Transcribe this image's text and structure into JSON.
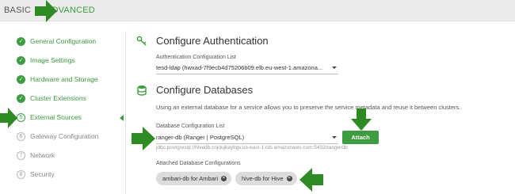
{
  "header": {
    "basic_tab": "BASIC",
    "advanced_tab": "ADVANCED"
  },
  "nav": {
    "items": [
      {
        "number": "",
        "label": "General Configuration",
        "state": "done"
      },
      {
        "number": "",
        "label": "Image Settings",
        "state": "done"
      },
      {
        "number": "",
        "label": "Hardware and Storage",
        "state": "done"
      },
      {
        "number": "",
        "label": "Cluster Extensions",
        "state": "done"
      },
      {
        "number": "5",
        "label": "External Sources",
        "state": "current"
      },
      {
        "number": "6",
        "label": "Gateway Configuration",
        "state": "pending"
      },
      {
        "number": "7",
        "label": "Network",
        "state": "pending"
      },
      {
        "number": "8",
        "label": "Security",
        "state": "pending"
      }
    ]
  },
  "auth": {
    "title": "Configure Authentication",
    "list_label": "Authentication Configuration List",
    "selected": "tesd-ldap (hwxad-7f9ecb4d75206b09.elb.eu-west-1.amazona..."
  },
  "databases": {
    "title": "Configure Databases",
    "description": "Using an external database for a service allows you to preserve the service metadata and reuse it between clusters.",
    "list_label": "Database Configuration List",
    "selected": "ranger-db (Ranger | PostgreSQL)",
    "jdbc_url": "jdbc:postgresql://hivedb.cnjdujkaybgv.us-east-1.rds.amazonaws.com:5432/rangerdb",
    "attach_label": "Attach",
    "attached_label": "Attached Database Configurations",
    "attached": [
      "ambari-db for Ambari",
      "hive-db for Hive"
    ]
  },
  "colors": {
    "accent": "#3c9c3f",
    "chip_bg": "#dcdcdc",
    "arrow": "#2e8b23"
  }
}
